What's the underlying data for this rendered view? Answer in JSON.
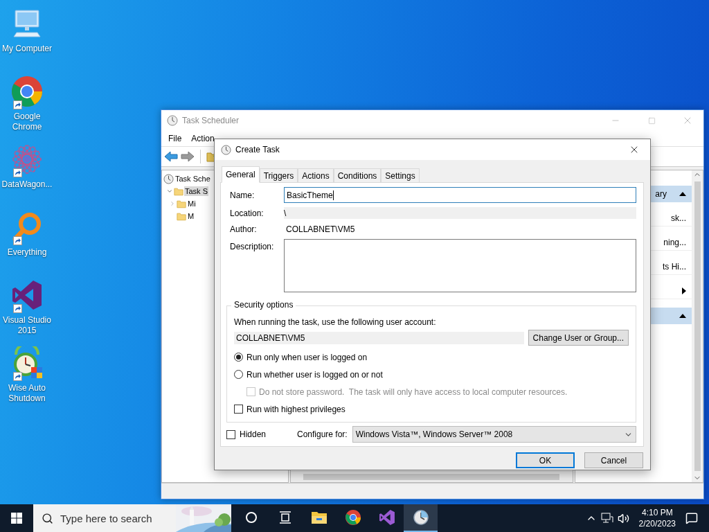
{
  "desktop": {
    "icons": [
      {
        "label": "My Computer",
        "kind": "computer",
        "shortcut": false
      },
      {
        "label": "Google Chrome",
        "kind": "chrome",
        "shortcut": true
      },
      {
        "label": "DataWagon...",
        "kind": "datawagon",
        "shortcut": true
      },
      {
        "label": "Everything",
        "kind": "everything",
        "shortcut": true
      },
      {
        "label": "Visual Studio 2015",
        "kind": "visualstudio",
        "shortcut": true
      },
      {
        "label": "Wise Auto Shutdown",
        "kind": "wiseshutdown",
        "shortcut": true
      }
    ]
  },
  "task_scheduler": {
    "title": "Task Scheduler",
    "menu": [
      "File",
      "Action"
    ],
    "tree": [
      {
        "label": "Task Sche",
        "selected": false,
        "children": [
          {
            "label": "Task S",
            "selected": true,
            "expanded": true,
            "children": [
              {
                "label": "Mi",
                "selected": false,
                "expanded": false
              },
              {
                "label": "M",
                "selected": false
              }
            ]
          }
        ]
      }
    ],
    "actions": [
      {
        "kind": "header",
        "label": "ary"
      },
      {
        "kind": "action",
        "label": "sk..."
      },
      {
        "kind": "action",
        "label": "ning..."
      },
      {
        "kind": "action",
        "label": "ts Hi..."
      },
      {
        "kind": "submenu"
      },
      {
        "kind": "header"
      }
    ]
  },
  "dialog": {
    "title": "Create Task",
    "tabs": [
      {
        "label": "General",
        "selected": true
      },
      {
        "label": "Triggers",
        "selected": false
      },
      {
        "label": "Actions",
        "selected": false
      },
      {
        "label": "Conditions",
        "selected": false
      },
      {
        "label": "Settings",
        "selected": false
      }
    ],
    "fields": [
      {
        "kind": "input",
        "label": "Name:",
        "value": "BasicTheme",
        "focused": true
      },
      {
        "kind": "readonly",
        "label": "Location:",
        "value": "\\"
      },
      {
        "kind": "text",
        "label": "Author:",
        "value": "COLLABNET\\VM5"
      },
      {
        "kind": "textarea",
        "label": "Description:"
      }
    ],
    "security": {
      "legend": "Security options",
      "prompt": "When running the task, use the following user account:",
      "account": "COLLABNET\\VM5",
      "change_button": "Change User or Group...",
      "options": [
        {
          "kind": "radio",
          "label": "Run only when user is logged on",
          "selected": true
        },
        {
          "kind": "radio",
          "label": "Run whether user is logged on or not",
          "selected": false,
          "children": [
            {
              "kind": "checkbox",
              "label": "Do not store password.  The task will only have access to local computer resources.",
              "checked": false,
              "disabled": true
            }
          ]
        },
        {
          "kind": "checkbox",
          "label": "Run with highest privileges",
          "checked": false,
          "disabled": false
        }
      ]
    },
    "hidden": {
      "label": "Hidden",
      "checked": false
    },
    "configure": {
      "label": "Configure for:",
      "value": "Windows Vista™, Windows Server™ 2008"
    },
    "buttons": [
      {
        "label": "OK",
        "default": true
      },
      {
        "label": "Cancel",
        "default": false
      }
    ]
  },
  "taskbar": {
    "search_placeholder": "Type here to search",
    "apps": [
      {
        "kind": "cortana",
        "active": false
      },
      {
        "kind": "taskview",
        "active": false
      },
      {
        "kind": "explorer",
        "active": false
      },
      {
        "kind": "chrome",
        "active": false
      },
      {
        "kind": "visualstudio",
        "active": false
      },
      {
        "kind": "scheduler",
        "active": true
      }
    ],
    "time": "4:10 PM",
    "date": "2/20/2023"
  }
}
